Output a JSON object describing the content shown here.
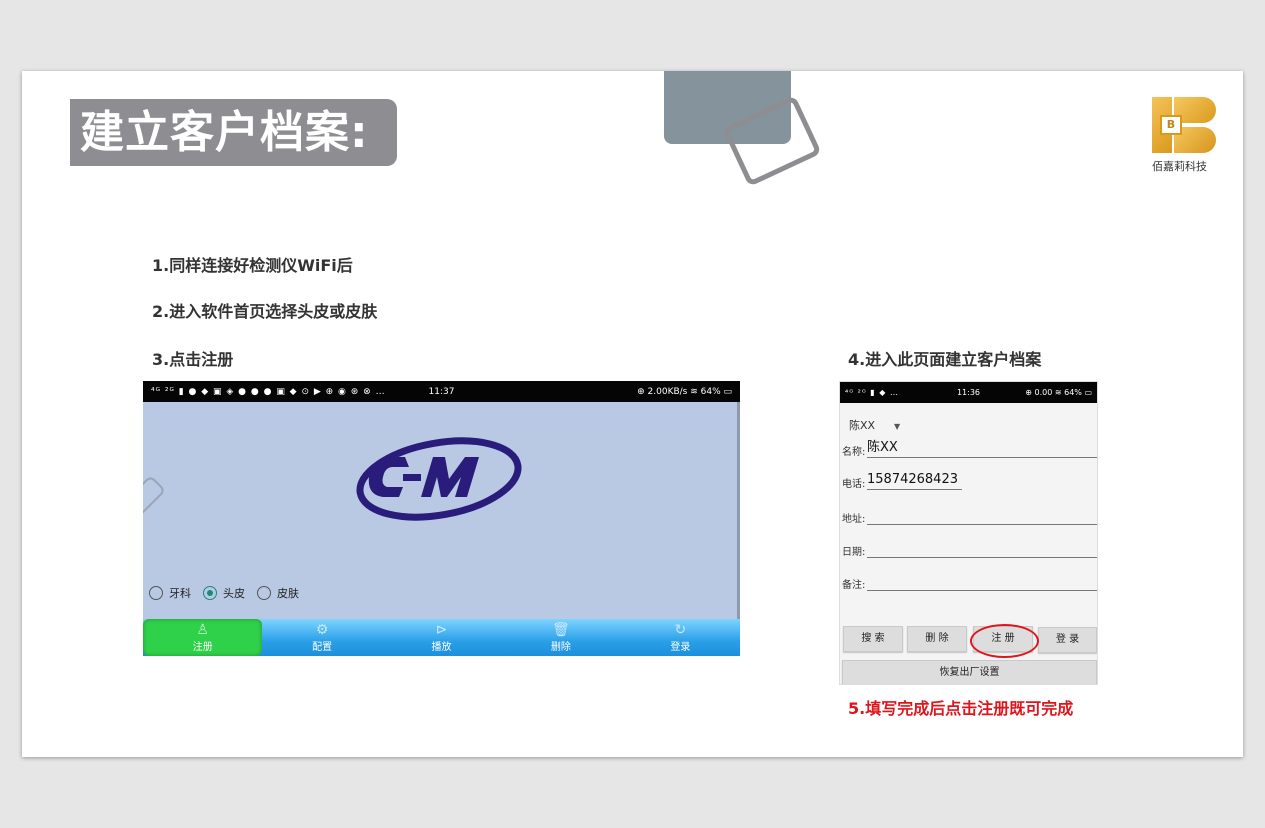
{
  "slide": {
    "title": "建立客户档案:",
    "brand": "佰嘉莉科技",
    "brand_mark": "B"
  },
  "steps": {
    "s1": "1.同样连接好检测仪WiFi后",
    "s2": "2.进入软件首页选择头皮或皮肤",
    "s3": "3.点击注册",
    "s4": "4.进入此页面建立客户档案",
    "s5": "5.填写完成后点击注册既可完成"
  },
  "colors": {
    "title_bg": "#8e8d92",
    "accent_red": "#e0151b",
    "nav_blue": "#2aa0e8",
    "nav_active_green": "#2fd04a",
    "logo_gold": "#d99a1c",
    "cm_logo_navy": "#2a1c7a"
  },
  "screenshot1": {
    "status_left": "⁴ᴳ ²ᴳ ▮ ● ◆ ▣ ◈ ● ● ● ▣ ◆ ⊙ ▶ ⊕ ◉ ⊛ ⊗ …",
    "status_time": "11:37",
    "status_right": "⊕ 2.00KB/s ≋ 64% ▭",
    "radios": [
      {
        "label": "牙科",
        "selected": false
      },
      {
        "label": "头皮",
        "selected": true
      },
      {
        "label": "皮肤",
        "selected": false
      }
    ],
    "nav": [
      {
        "label": "注册",
        "icon": "person-icon",
        "glyph": "♙",
        "active": true
      },
      {
        "label": "配置",
        "icon": "gear-icon",
        "glyph": "⚙",
        "active": false
      },
      {
        "label": "播放",
        "icon": "play-icon",
        "glyph": "⊳",
        "active": false
      },
      {
        "label": "删除",
        "icon": "trash-icon",
        "glyph": "🗑",
        "active": false
      },
      {
        "label": "登录",
        "icon": "refresh-icon",
        "glyph": "↻",
        "active": false
      }
    ]
  },
  "screenshot2": {
    "status_left": "⁴ᴳ ²ᴳ ▮ ◆ …",
    "status_time": "11:36",
    "status_right": "⊕ 0.00 ≋ 64% ▭",
    "selected_customer": "陈XX",
    "fields": {
      "name_label": "名称:",
      "name_value": "陈XX",
      "phone_label": "电话:",
      "phone_value": "15874268423",
      "address_label": "地址:",
      "address_value": "",
      "date_label": "日期:",
      "date_value": "",
      "note_label": "备注:",
      "note_value": ""
    },
    "buttons": {
      "search": "搜 索",
      "delete": "删 除",
      "register": "注 册",
      "login": "登 录",
      "reset": "恢复出厂设置"
    }
  }
}
